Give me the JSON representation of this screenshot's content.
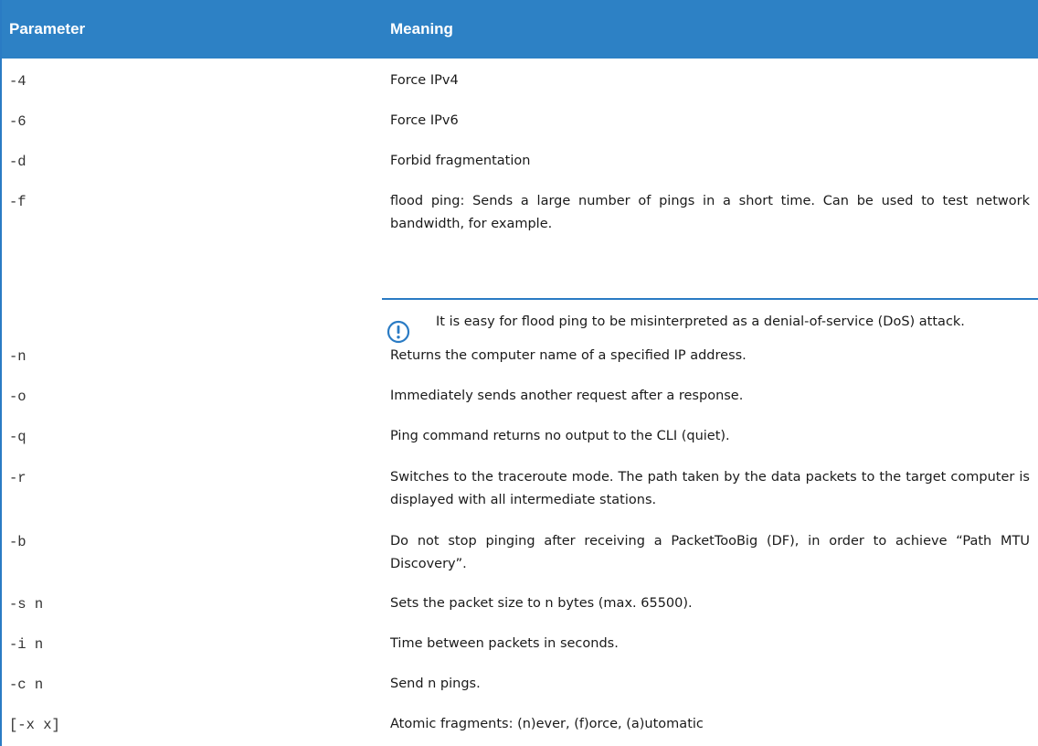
{
  "header": {
    "col_param": "Parameter",
    "col_meaning": "Meaning"
  },
  "rows": [
    {
      "param": "-4",
      "meaning": "Force IPv4"
    },
    {
      "param": "-6",
      "meaning": "Force IPv6"
    },
    {
      "param": "-d",
      "meaning": "Forbid fragmentation"
    },
    {
      "param": "-f",
      "meaning": "flood ping: Sends a large number of pings in a short time. Can be used to test network bandwidth, for example."
    },
    {
      "param": "-n",
      "meaning": "Returns the computer name of a specified IP address."
    },
    {
      "param": "-o",
      "meaning": "Immediately sends another request after a response."
    },
    {
      "param": "-q",
      "meaning": "Ping command returns no output to the CLI (quiet)."
    },
    {
      "param": "-r",
      "meaning": "Switches to the traceroute mode. The path taken by the data packets to the target computer is displayed with all intermediate stations."
    },
    {
      "param": "-b",
      "meaning": "Do not stop pinging after receiving a PacketTooBig (DF), in order to achieve “Path MTU Discovery”."
    },
    {
      "param": "-s n",
      "meaning": "Sets the packet size to n bytes (max. 65500)."
    },
    {
      "param": "-i n",
      "meaning": "Time between packets in seconds."
    },
    {
      "param": "-c n",
      "meaning": "Send n pings."
    },
    {
      "param": "[-x x]",
      "meaning": "Atomic fragments: (n)ever, (f)orce, (a)utomatic"
    }
  ],
  "note": {
    "icon": "warning-exclamation-icon",
    "text": "It is easy for flood ping to be misinterpreted as a denial-of-service (DoS) attack."
  },
  "colors": {
    "header_bg": "#2d81c5",
    "header_text": "#ffffff",
    "accent": "#2a7bc4"
  }
}
